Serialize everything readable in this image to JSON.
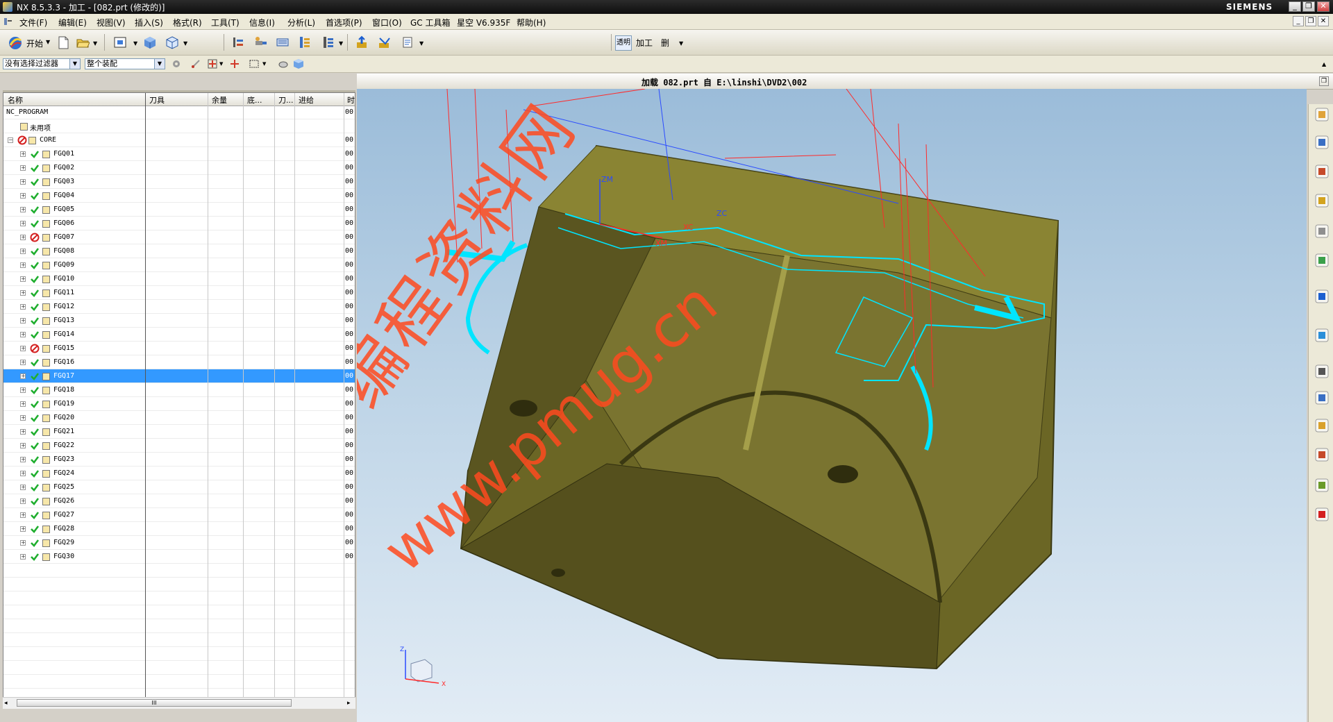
{
  "window": {
    "title": "NX 8.5.3.3 - 加工 - [082.prt (修改的)]",
    "brand": "SIEMENS",
    "controls": [
      "_",
      "❐",
      "✕"
    ]
  },
  "menu": {
    "items": [
      "文件(F)",
      "编辑(E)",
      "视图(V)",
      "插入(S)",
      "格式(R)",
      "工具(T)",
      "信息(I)",
      "分析(L)",
      "首选项(P)",
      "窗口(O)",
      "GC 工具箱",
      "星空 V6.935F",
      "帮助(H)"
    ]
  },
  "toolbar": {
    "start_label": "开始",
    "filter_value": "没有选择过滤器",
    "assembly_value": "整个装配",
    "op_buttons": [
      "透明",
      "加工",
      "删"
    ]
  },
  "navigator": {
    "columns": [
      "名称",
      "刀具",
      "余量",
      "底...",
      "刀...",
      "进给",
      "时"
    ],
    "root": "NC_PROGRAM",
    "unused": "未用项",
    "group": "CORE",
    "time_prefix": "00",
    "selected": "FGQ17",
    "ops": [
      {
        "name": "FGQ01",
        "status": "ok"
      },
      {
        "name": "FGQ02",
        "status": "ok"
      },
      {
        "name": "FGQ03",
        "status": "ok"
      },
      {
        "name": "FGQ04",
        "status": "ok"
      },
      {
        "name": "FGQ05",
        "status": "ok"
      },
      {
        "name": "FGQ06",
        "status": "ok"
      },
      {
        "name": "FGQ07",
        "status": "regen"
      },
      {
        "name": "FGQ08",
        "status": "ok"
      },
      {
        "name": "FGQ09",
        "status": "ok"
      },
      {
        "name": "FGQ10",
        "status": "ok"
      },
      {
        "name": "FGQ11",
        "status": "ok"
      },
      {
        "name": "FGQ12",
        "status": "ok"
      },
      {
        "name": "FGQ13",
        "status": "ok"
      },
      {
        "name": "FGQ14",
        "status": "ok"
      },
      {
        "name": "FGQ15",
        "status": "regen"
      },
      {
        "name": "FGQ16",
        "status": "ok"
      },
      {
        "name": "FGQ17",
        "status": "ok"
      },
      {
        "name": "FGQ18",
        "status": "ok"
      },
      {
        "name": "FGQ19",
        "status": "ok"
      },
      {
        "name": "FGQ20",
        "status": "ok"
      },
      {
        "name": "FGQ21",
        "status": "ok"
      },
      {
        "name": "FGQ22",
        "status": "ok"
      },
      {
        "name": "FGQ23",
        "status": "ok"
      },
      {
        "name": "FGQ24",
        "status": "ok"
      },
      {
        "name": "FGQ25",
        "status": "ok"
      },
      {
        "name": "FGQ26",
        "status": "ok"
      },
      {
        "name": "FGQ27",
        "status": "ok"
      },
      {
        "name": "FGQ28",
        "status": "ok"
      },
      {
        "name": "FGQ29",
        "status": "ok"
      },
      {
        "name": "FGQ30",
        "status": "ok"
      }
    ],
    "scroll_grip": "III"
  },
  "graphics": {
    "title": "加载 082.prt 自 E:\\linshi\\DVD2\\002",
    "watermark_cn": "编程资料网",
    "watermark_url": "www.pmug.cn",
    "labels": {
      "zm": "ZM",
      "xm": "XM",
      "zc": "ZC",
      "xc": "XC",
      "axis_z": "Z",
      "axis_x": "X"
    },
    "colors": {
      "part": "#6f6a22",
      "toolpath": "#00e5ff",
      "watermark": "#ff3300"
    }
  },
  "resource_bar": {
    "icons": [
      "assembly-navigator-icon",
      "constraint-navigator-icon",
      "part-navigator-icon",
      "machine-tool-navigator-icon",
      "operation-navigator-icon",
      "reuse-library-icon",
      "roles-icon",
      "web-browser-icon",
      "history-icon",
      "process-studio-icon",
      "visualization-icon",
      "system-materials-icon",
      "user-icon",
      "palette-icon"
    ]
  }
}
